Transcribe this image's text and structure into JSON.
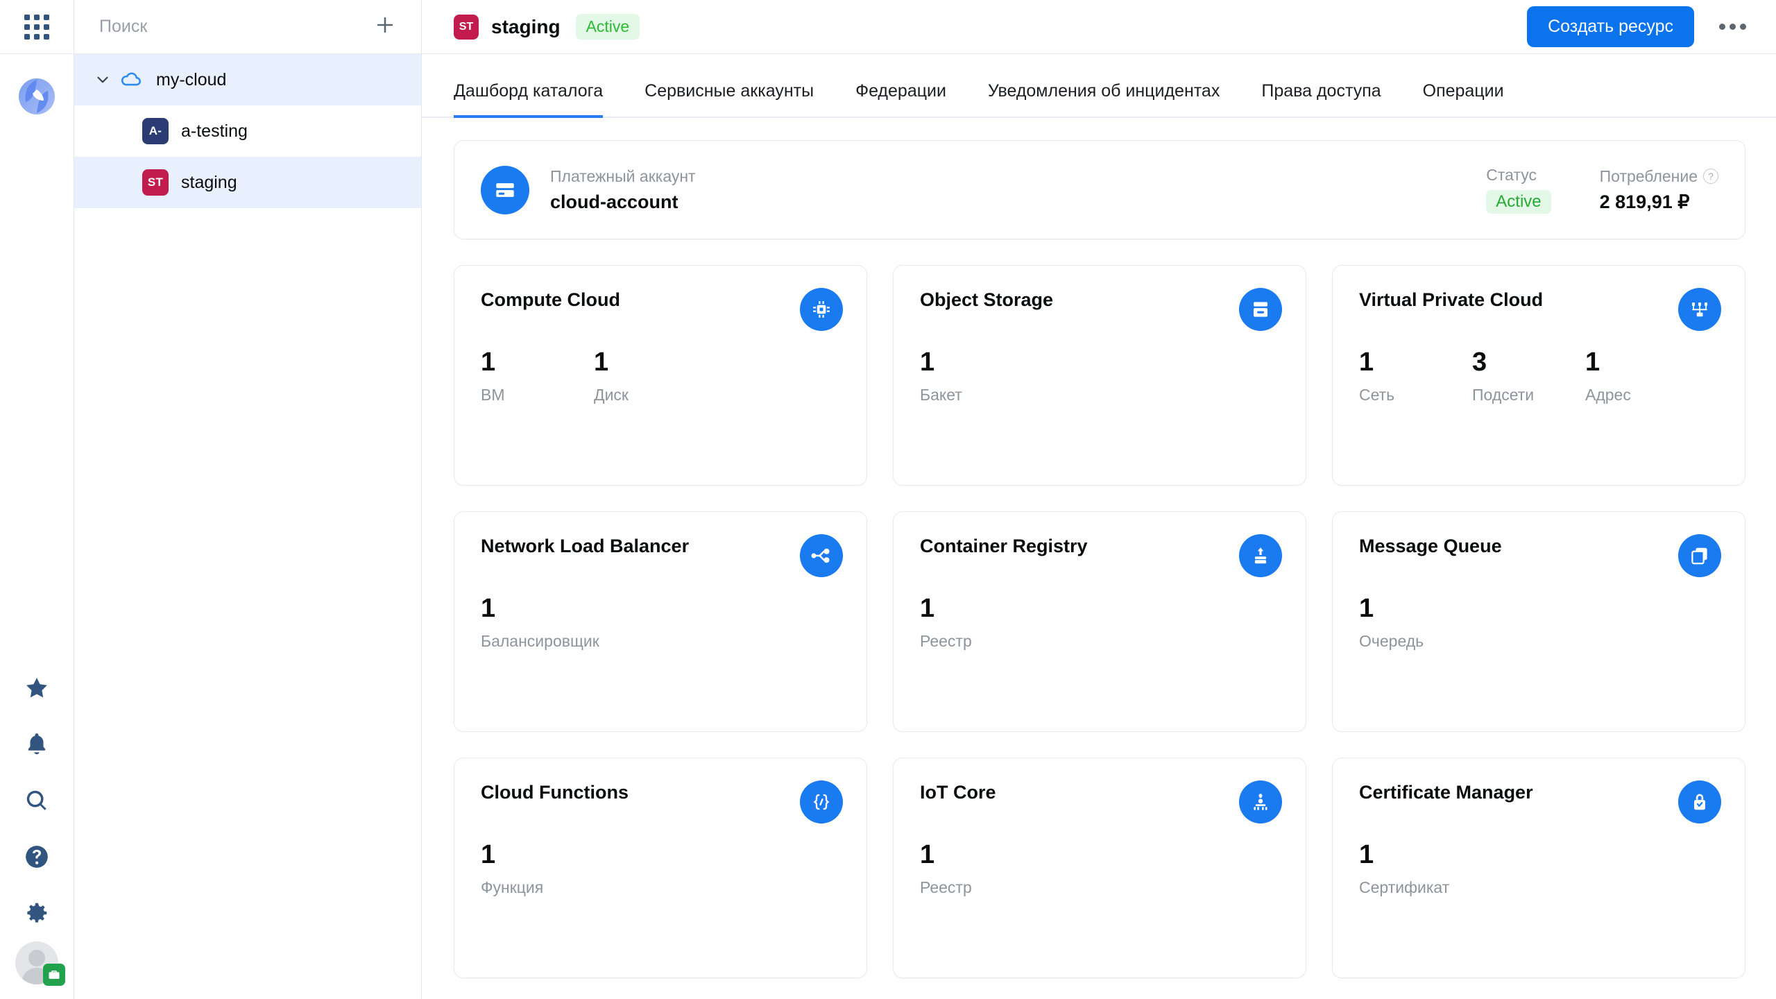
{
  "rail": {
    "apps_icon": "grid-apps-icon",
    "logo_icon": "cloud-logo-icon",
    "items": [
      {
        "icon": "star-icon",
        "name": "favorites"
      },
      {
        "icon": "bell-icon",
        "name": "notifications"
      },
      {
        "icon": "search-icon",
        "name": "search"
      },
      {
        "icon": "question-circle-icon",
        "name": "help"
      },
      {
        "icon": "gear-icon",
        "name": "settings"
      }
    ],
    "avatar": {
      "icon": "avatar",
      "badge_icon": "briefcase-icon",
      "badge_color": "#23a24d"
    }
  },
  "tree": {
    "search": {
      "placeholder": "Поиск",
      "value": ""
    },
    "add_label": "+",
    "nodes": [
      {
        "label": "my-cloud",
        "icon": "cloud-icon",
        "type": "cloud",
        "selected": true,
        "expanded": true
      },
      {
        "label": "a-testing",
        "badge": "A-",
        "badge_color": "#2a3c73",
        "type": "folder",
        "selected": false
      },
      {
        "label": "staging",
        "badge": "ST",
        "badge_color": "#c21c4e",
        "type": "folder",
        "selected": true
      }
    ]
  },
  "header": {
    "badge": "ST",
    "badge_color": "#c21c4e",
    "title": "staging",
    "status": "Active",
    "create_button": "Создать ресурс",
    "more_icon": "ellipsis-icon"
  },
  "tabs": [
    {
      "label": "Дашборд каталога",
      "active": true
    },
    {
      "label": "Сервисные аккаунты",
      "active": false
    },
    {
      "label": "Федерации",
      "active": false
    },
    {
      "label": "Уведомления об инцидентах",
      "active": false
    },
    {
      "label": "Права доступа",
      "active": false
    },
    {
      "label": "Операции",
      "active": false
    }
  ],
  "billing": {
    "icon": "credit-card-icon",
    "label": "Платежный аккаунт",
    "name": "cloud-account",
    "status_label": "Статус",
    "status_value": "Active",
    "consumption_label": "Потребление",
    "consumption_hint": "?",
    "consumption_value": "2 819,91 ₽"
  },
  "services": [
    {
      "title": "Compute Cloud",
      "icon": "chip-icon",
      "stats": [
        {
          "value": "1",
          "label": "ВМ"
        },
        {
          "value": "1",
          "label": "Диск"
        }
      ]
    },
    {
      "title": "Object Storage",
      "icon": "storage-bucket-icon",
      "stats": [
        {
          "value": "1",
          "label": "Бакет"
        }
      ]
    },
    {
      "title": "Virtual Private Cloud",
      "icon": "network-icon",
      "stats": [
        {
          "value": "1",
          "label": "Сеть"
        },
        {
          "value": "3",
          "label": "Подсети"
        },
        {
          "value": "1",
          "label": "Адрес"
        }
      ]
    },
    {
      "title": "Network Load Balancer",
      "icon": "load-balancer-icon",
      "stats": [
        {
          "value": "1",
          "label": "Балансировщик"
        }
      ]
    },
    {
      "title": "Container Registry",
      "icon": "container-registry-icon",
      "stats": [
        {
          "value": "1",
          "label": "Реестр"
        }
      ]
    },
    {
      "title": "Message Queue",
      "icon": "message-queue-icon",
      "stats": [
        {
          "value": "1",
          "label": "Очередь"
        }
      ]
    },
    {
      "title": "Cloud Functions",
      "icon": "braces-icon",
      "stats": [
        {
          "value": "1",
          "label": "Функция"
        }
      ]
    },
    {
      "title": "IoT Core",
      "icon": "iot-core-icon",
      "stats": [
        {
          "value": "1",
          "label": "Реестр"
        }
      ]
    },
    {
      "title": "Certificate Manager",
      "icon": "lock-icon",
      "stats": [
        {
          "value": "1",
          "label": "Сертификат"
        }
      ]
    }
  ],
  "colors": {
    "accent": "#0b73ec",
    "icon_blue": "#1a7aef",
    "status_green": "#27a936",
    "status_green_bg": "#e3f8e6",
    "selected_row": "#e8f0fe",
    "muted_text": "#8e949c"
  }
}
